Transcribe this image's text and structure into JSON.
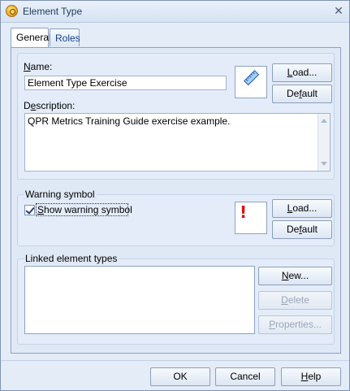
{
  "window": {
    "title": "Element Type",
    "close_glyph": "✕"
  },
  "tabs": [
    {
      "label": "General",
      "active": true
    },
    {
      "label": "Roles",
      "active": false
    }
  ],
  "general": {
    "name_label_u": "N",
    "name_label_rest": "ame:",
    "name_value": "Element Type Exercise",
    "description_label_pre": "D",
    "description_label_u": "e",
    "description_label_rest": "scription:",
    "description_value": "QPR Metrics Training Guide exercise example.",
    "symbol_icon": "ruler-icon",
    "load_button_u": "L",
    "load_button_rest": "oad...",
    "default_button_pre": "De",
    "default_button_u": "f",
    "default_button_rest": "ault"
  },
  "warning": {
    "group_label": "Warning symbol",
    "checkbox_checked": true,
    "checkbox_label_u": "S",
    "checkbox_label_rest": "how warning symbol",
    "symbol_icon": "exclamation-icon",
    "symbol_glyph": "!",
    "load_button_u": "L",
    "load_button_rest": "oad...",
    "default_button_pre": "De",
    "default_button_u": "f",
    "default_button_rest": "ault"
  },
  "linked": {
    "group_label": "Linked element types",
    "items": [],
    "new_button_u": "N",
    "new_button_rest": "ew...",
    "delete_button_u": "D",
    "delete_button_rest": "elete",
    "properties_button_u": "P",
    "properties_button_rest": "roperties..."
  },
  "footer": {
    "ok_label": "OK",
    "cancel_label": "Cancel",
    "help_label_u": "H",
    "help_label_rest": "elp"
  },
  "colors": {
    "warning_symbol": "#e01010",
    "tab_inactive_text": "#15428b",
    "title_text": "#1e395b"
  }
}
